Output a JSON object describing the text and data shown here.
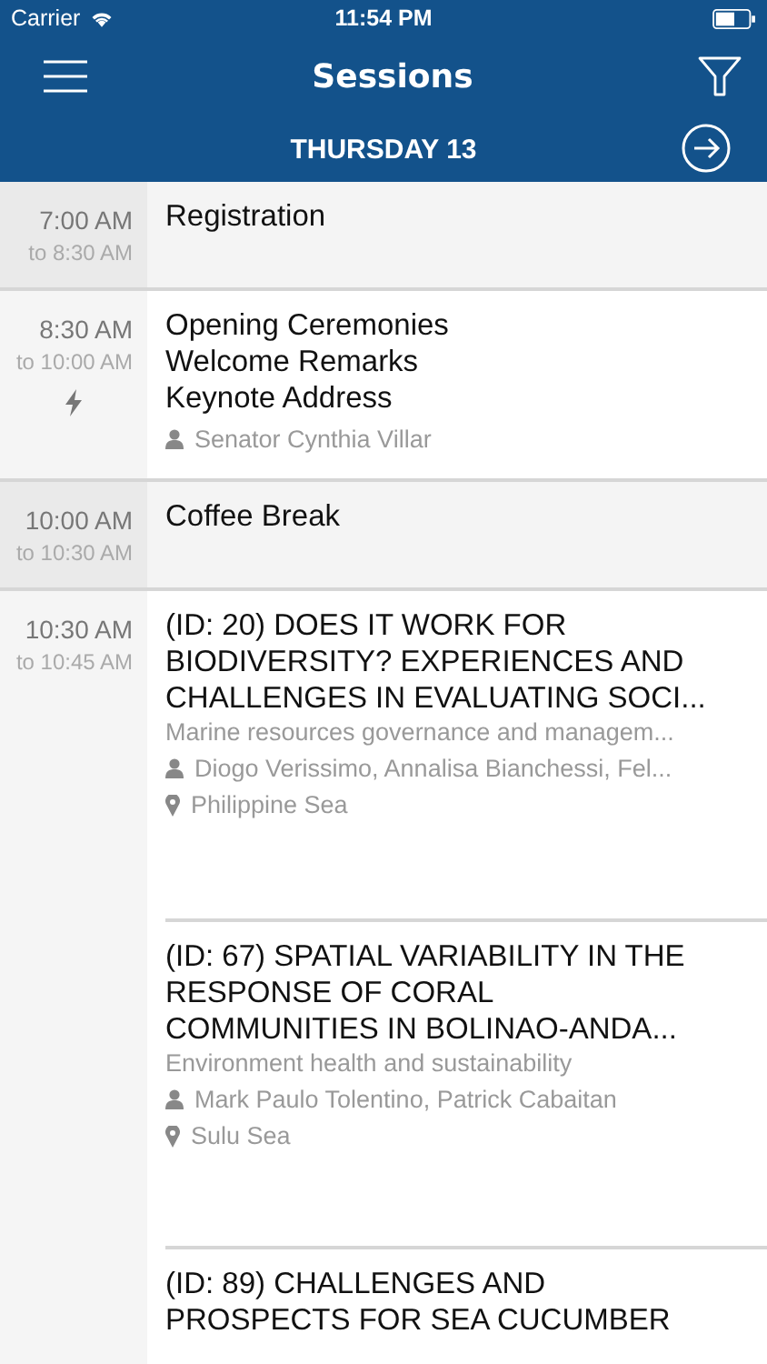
{
  "status_bar": {
    "carrier": "Carrier",
    "time": "11:54 PM"
  },
  "nav": {
    "title": "Sessions"
  },
  "day_bar": {
    "label": "THURSDAY 13"
  },
  "slots": [
    {
      "start": "7:00 AM",
      "end": "to 8:30 AM",
      "highlighted": true,
      "featured": false,
      "sessions": [
        {
          "title_lines": [
            "Registration"
          ]
        }
      ]
    },
    {
      "start": "8:30 AM",
      "end": "to 10:00 AM",
      "highlighted": false,
      "featured": true,
      "sessions": [
        {
          "title_lines": [
            "Opening Ceremonies",
            "Welcome Remarks",
            "Keynote Address"
          ],
          "speakers": "Senator Cynthia Villar"
        }
      ]
    },
    {
      "start": "10:00 AM",
      "end": "to 10:30 AM",
      "highlighted": true,
      "featured": false,
      "sessions": [
        {
          "title_lines": [
            "Coffee Break"
          ]
        }
      ]
    },
    {
      "start": "10:30 AM",
      "end": "to 10:45 AM",
      "highlighted": false,
      "featured": false,
      "sessions": [
        {
          "title_lines": [
            "(ID: 20) DOES IT WORK FOR",
            "BIODIVERSITY? EXPERIENCES AND",
            "CHALLENGES IN EVALUATING SOCI..."
          ],
          "track": "Marine resources governance and managem...",
          "speakers": "Diogo Verissimo, Annalisa Bianchessi, Fel...",
          "location": "Philippine Sea"
        },
        {
          "title_lines": [
            "(ID: 67) SPATIAL VARIABILITY IN THE",
            "RESPONSE OF CORAL",
            "COMMUNITIES IN BOLINAO-ANDA..."
          ],
          "track": "Environment health and sustainability",
          "speakers": "Mark Paulo Tolentino, Patrick Cabaitan",
          "location": "Sulu Sea"
        },
        {
          "title_lines": [
            "(ID: 89) CHALLENGES AND",
            "PROSPECTS FOR SEA CUCUMBER"
          ]
        }
      ]
    }
  ]
}
